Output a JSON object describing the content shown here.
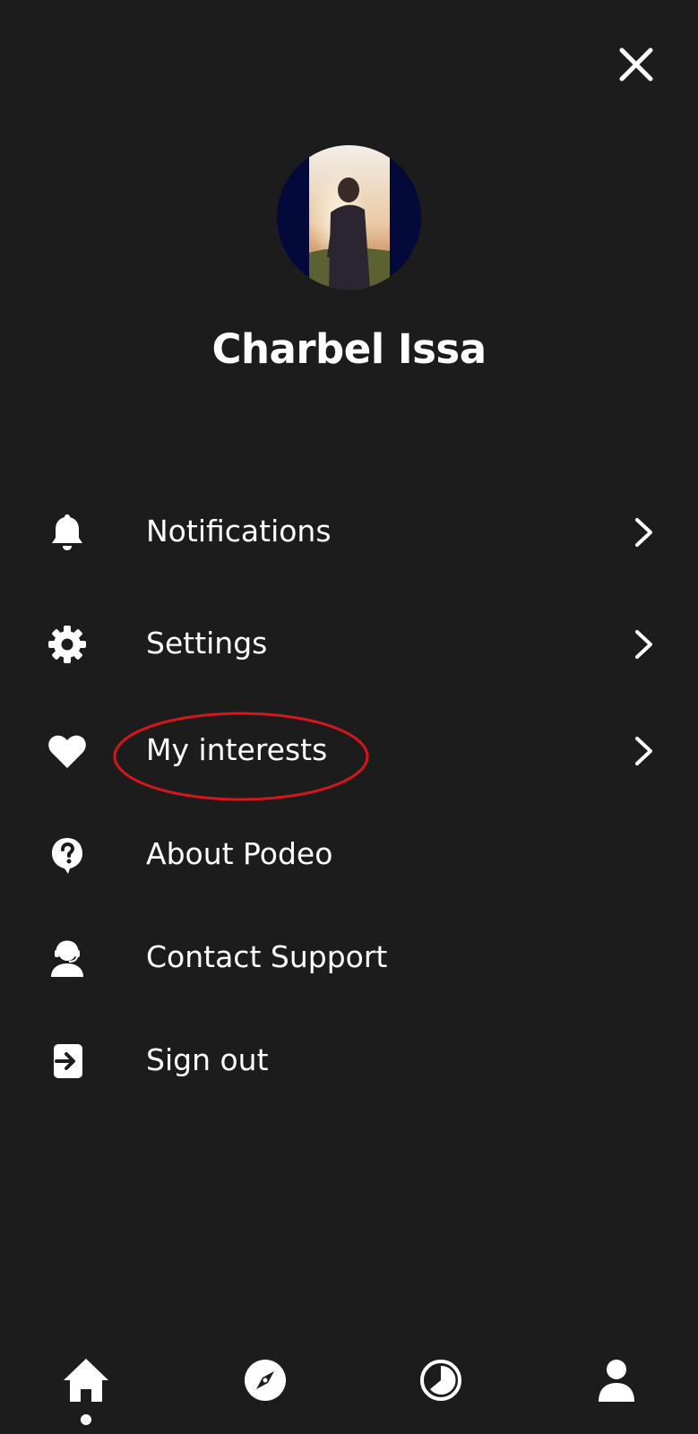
{
  "header": {
    "close_icon": "close-icon"
  },
  "profile": {
    "name": "Charbel Issa",
    "avatar_background": "#030a3a"
  },
  "menu": {
    "items": [
      {
        "label": "Notifications",
        "icon": "bell-icon",
        "has_chevron": true
      },
      {
        "label": "Settings",
        "icon": "gear-icon",
        "has_chevron": true
      },
      {
        "label": "My interests",
        "icon": "heart-icon",
        "has_chevron": true,
        "highlighted": true
      },
      {
        "label": "About Podeo",
        "icon": "question-bubble-icon",
        "has_chevron": false
      },
      {
        "label": "Contact Support",
        "icon": "support-agent-icon",
        "has_chevron": false
      },
      {
        "label": "Sign out",
        "icon": "sign-out-icon",
        "has_chevron": false
      }
    ]
  },
  "bottom_nav": {
    "items": [
      {
        "icon": "home-icon",
        "active": true
      },
      {
        "icon": "compass-icon",
        "active": false
      },
      {
        "icon": "history-icon",
        "active": false
      },
      {
        "icon": "profile-icon",
        "active": false
      }
    ]
  },
  "colors": {
    "background": "#1c1c1c",
    "text": "#ffffff",
    "highlight_annotation": "#d4161d"
  }
}
